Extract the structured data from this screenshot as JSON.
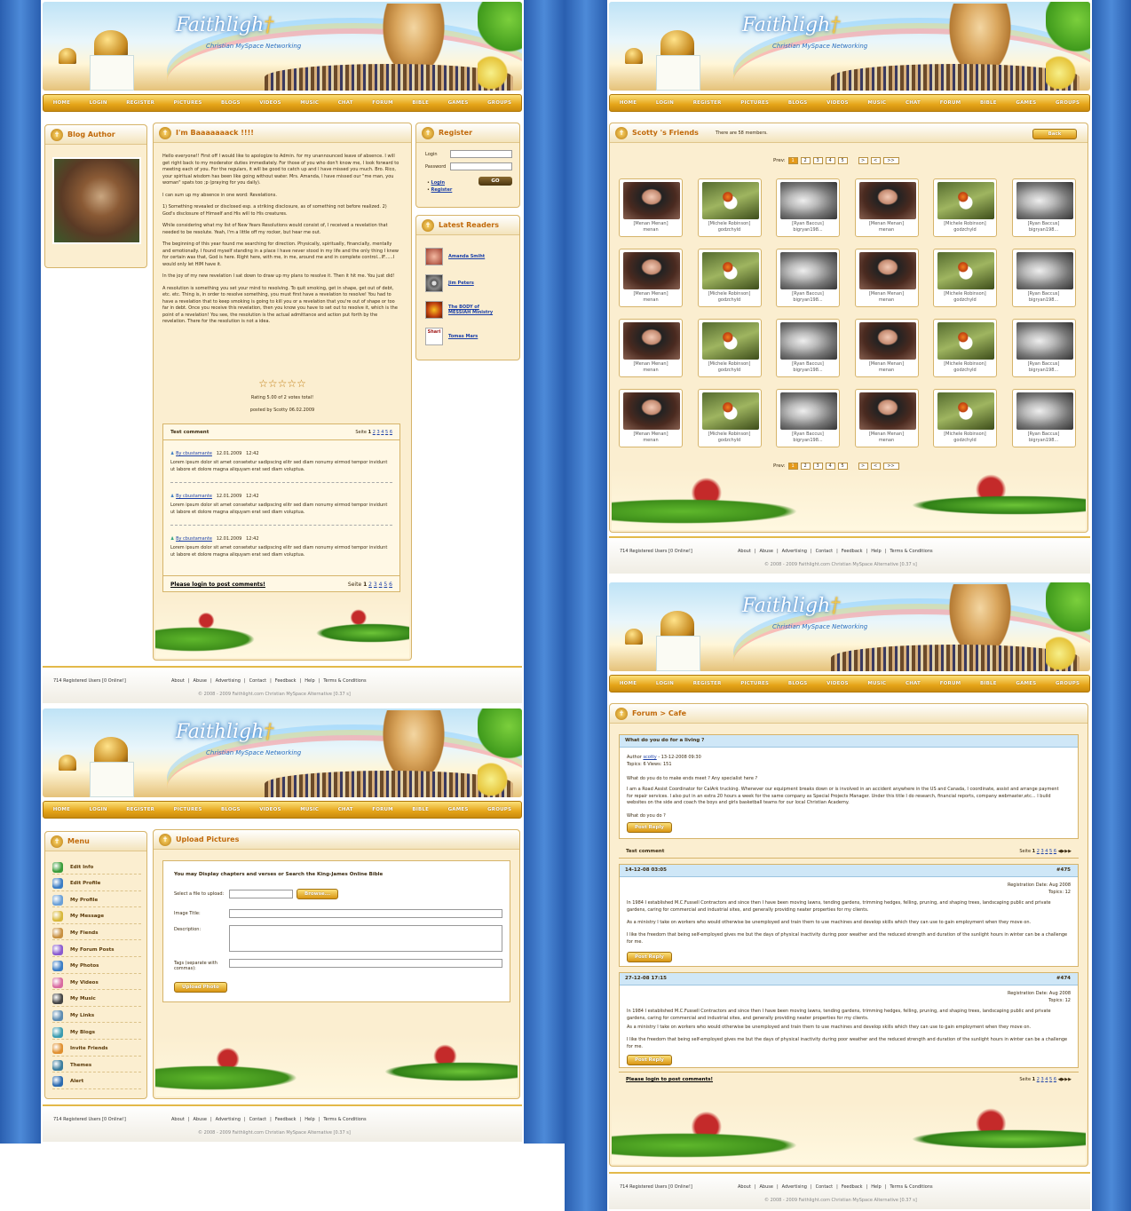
{
  "brand": {
    "logo": "Faithligh",
    "tagline": "Christian MySpace Networking"
  },
  "nav": [
    "HOME",
    "LOGIN",
    "REGISTER",
    "PICTURES",
    "BLOGS",
    "VIDEOS",
    "MUSIC",
    "CHAT",
    "FORUM",
    "BIBLE",
    "GAMES",
    "GROUPS"
  ],
  "footer": {
    "registered": "714 Registered Users [0 Online!]",
    "links": [
      "About",
      "|",
      "Abuse",
      "|",
      "Advertising",
      "|",
      "Contact",
      "|",
      "Feedback",
      "|",
      "Help",
      "|",
      "Terms & Conditions"
    ],
    "copyright": "© 2008 - 2009 Faithlight.com Christian MySpace Alternative [0.37 s]"
  },
  "blog": {
    "author_title": "Blog Author",
    "post_title": "I'm Baaaaaaack !!!!",
    "paragraphs": [
      "Hello everyone!! First off I would like to apologize to Admin. for my unannounced leave of absence. I will get right back to my moderator duties immediately. For those of you who don't know me, I look forward to meeting each of you. For the regulars, it will be good to catch up and I have missed you much. Bro. Rico, your spiritual wisdom has been like going without water. Mrs. Amanda, I have missed our \"me man, you woman\" spats too ;p (praying for you daily).",
      "I can sum up my absence in one word: Revelations.",
      "1) Something revealed or disclosed esp. a striking disclosure, as of something not before realized. 2) God's disclosure of Himself and His will to His creatures.",
      "While considering what my list of New Years Resolutions would consist of, I received a revelation that needed to be resolute. Yeah, I'm a little off my rocker, but hear me out.",
      "The beginning of this year found me searching for direction. Physically, spiritually, financially, mentally and emotionally. I found myself standing in a place I have never stood in my life and the only thing I knew for certain was that, God is here. Right here, with me, in me, around me and in complete control...IF......I would only let HIM have it.",
      "In the joy of my new revelation I sat down to draw up my plans to resolve it. Then it hit me. You just did!",
      "A resolution is something you set your mind to resolving. To quit smoking, get in shape, get out of debt, etc. etc. Thing is, in order to resolve something, you must first have a revelation to resolve! You had to have a revelation that to keep smoking is going to kill you or a revelation that you're out of shape or too far in debt. Once you receive this revelation, then you know you have to set out to resolve it, which is the point of a revelation! You see, the resolution is the actual admittance and action put forth by the revelation. There for the resolution is not a idea."
    ],
    "stars": "☆☆☆☆☆",
    "rating": "Rating 5.00 of 2 votes total!",
    "posted_by": "posted by Scotty 06.02.2009",
    "comments_title": "Test comment",
    "seite_label": "Seite",
    "seite_pages": [
      "1",
      "2",
      "3",
      "4",
      "5",
      "6"
    ],
    "comments": [
      {
        "author": "By cbustamante",
        "date": "12.01.2009",
        "time": "12:42",
        "text": "Lorem ipsum dolor sit amet consetetur sadipscing elitr sed diam nonumy eirmod tempor invidunt ut labore et dolore magna aliquyam erat sed diam voluptua."
      },
      {
        "author": "By cbustamante",
        "date": "12.01.2009",
        "time": "12:42",
        "text": "Lorem ipsum dolor sit amet consetetur sadipscing elitr sed diam nonumy eirmod tempor invidunt ut labore et dolore magna aliquyam erat sed diam voluptua."
      },
      {
        "author": "By cbustamante",
        "date": "12.01.2009",
        "time": "12:42",
        "text": "Lorem ipsum dolor sit amet consetetur sadipscing elitr sed diam nonumy eirmod tempor invidunt ut labore et dolore magna aliquyam erat sed diam voluptua."
      }
    ],
    "login_prompt": "Please login to post comments!"
  },
  "register": {
    "title": "Register",
    "login_label": "Login",
    "password_label": "Password",
    "go": "GO",
    "login_link": "Login",
    "register_link": "Register"
  },
  "readers": {
    "title": "Latest Readers",
    "list": [
      "Amanda Smiht",
      "Jim Peters",
      "The BODY of MESSIAH Ministry",
      "Tomas Mars"
    ],
    "avatar4_text": "Shari"
  },
  "friends": {
    "title": "Scotty 's Friends",
    "count": "There are 58 members.",
    "back": "Back",
    "prev": "Prev:",
    "pages": [
      "1",
      "2",
      "3",
      "4",
      "5"
    ],
    "nav_arrows": [
      ">",
      "<",
      ">>"
    ],
    "people": [
      {
        "name": "[Menan Menan]",
        "user": "menan"
      },
      {
        "name": "[Michele Robinson]",
        "user": "godzchyld"
      },
      {
        "name": "[Ryan Baccus]",
        "user": "bigryan198..."
      }
    ]
  },
  "menu": {
    "title": "Menu",
    "items": [
      "Edit Info",
      "Edit Profile",
      "My Profile",
      "My Message",
      "My Fiends",
      "My Forum Posts",
      "My Photos",
      "My Videos",
      "My Music",
      "My Links",
      "My Blogs",
      "Invite Friends",
      "Themes",
      "Alert"
    ]
  },
  "upload": {
    "title": "Upload Pictures",
    "intro": "You may Display chapters and verses or Search the King-James Online Bible",
    "file_label": "Select a file to upload:",
    "browse": "Browse...",
    "image_title": "Image Title:",
    "description": "Description:",
    "tags": "Tags (separate with commas):",
    "submit": "Upload Photo"
  },
  "forum": {
    "crumb": "Forum > Cafe",
    "topic": "What do you do for a living ?",
    "author_line_pre": "Author",
    "author": "scotty",
    "author_line_post": "- 13-12-2008 09:30",
    "stats": "Topics: 6 Views: 151",
    "q": "What do you do to make ends meet ? Any specialist here ?",
    "body": "I am a Road Assist Coordinator for CalArk trucking. Whenever our equipment breaks down or is involved in an accident anywhere in the US and Canada, I coordinate, assist and arrange payment for repair services. I also put in an extra 20 hours a week for the same company as Special Projects Manager. Under this title I do research, financial reports, company webmaster,etc... I build websites on the side and coach the boys and girls basketball teams for our local Christian Academy.",
    "q2": "What do you do ?",
    "post_reply": "Post Reply",
    "comments_title": "Test comment",
    "seite": "Seite",
    "seite_pages": [
      "1",
      "2",
      "3",
      "4",
      "5",
      "6"
    ],
    "replies": [
      {
        "date": "14-12-08 03:05",
        "num": "#475",
        "reg": "Registration Date: Aug 2008",
        "topics": "Topics: 12",
        "p1": "In 1984 I established M.C.Fussell Contractors and since then I have been moving lawns, tending gardens, trimming hedges, felling, pruning, and shaping trees, landscaping public and private gardens, caring for commercial and industrial sites, and generally providing neater properties for my clients.",
        "p2": "As a ministry I take on workers who would otherwise be unemployed and train them to use machines and develop skills which they can use to gain employment when they move on.",
        "p3": "I like the freedom that being self-employed gives me but the days of physical inactivity during poor weather and the reduced strength and duration of the sunlight hours in winter can be a challenge for me."
      },
      {
        "date": "27-12-08 17:15",
        "num": "#474",
        "reg": "Registration Date: Aug 2008",
        "topics": "Topics: 12",
        "p1": "In 1984 I established M.C.Fussell Contractors and since then I have been moving lawns, tending gardens, trimming hedges, felling, pruning, and shaping trees, landscaping public and private gardens, caring for commercial and industrial sites, and generally providing neater properties for my clients.",
        "p2": "As a ministry I take on workers who would otherwise be unemployed and train them to use machines and develop skills which they can use to gain employment when they move on.",
        "p3": "I like the freedom that being self-employed gives me but the days of physical inactivity during poor weather and the reduced strength and duration of the sunlight hours in winter can be a challenge for me."
      }
    ],
    "login_prompt": "Please login to post comments!"
  }
}
